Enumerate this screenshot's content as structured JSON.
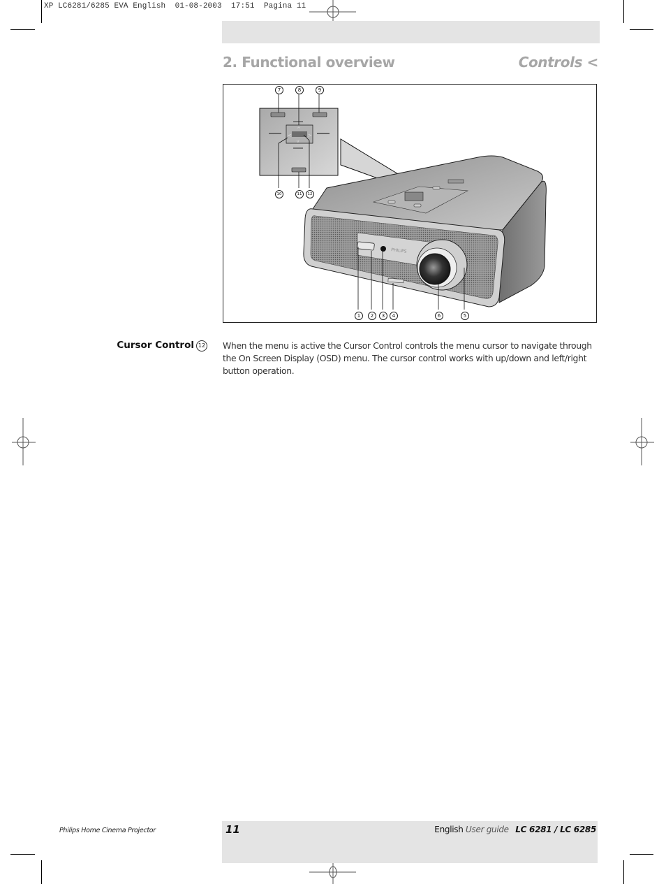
{
  "slug": {
    "text": "XP LC6281/6285 EVA English  01-08-2003  17:51  Pagina 11"
  },
  "header": {
    "section_title": "2. Functional overview",
    "subsection_title": "Controls <"
  },
  "figure": {
    "callouts": [
      "1",
      "2",
      "3",
      "4",
      "5",
      "6",
      "7",
      "8",
      "9",
      "10",
      "11",
      "12"
    ],
    "brand_on_device": "PHILIPS"
  },
  "content": {
    "item_title": "Cursor Control",
    "item_number": "12",
    "description": "When the menu is active the Cursor Control controls the menu cursor to navigate through the On Screen Display (OSD) menu. The cursor control works with up/down and left/right button operation."
  },
  "footer": {
    "product": "Philips Home Cinema Projector",
    "page_number": "11",
    "language": "English",
    "guide": "User guide",
    "models": "LC 6281 / LC 6285"
  }
}
